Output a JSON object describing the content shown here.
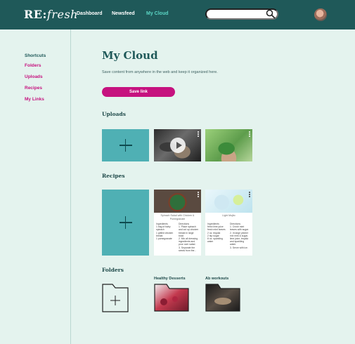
{
  "header": {
    "logo_prefix": "RE:",
    "logo_script": "fresh",
    "nav": [
      {
        "label": "Dashboard",
        "active": false
      },
      {
        "label": "Newsfeed",
        "active": false
      },
      {
        "label": "My Cloud",
        "active": true
      }
    ],
    "search": {
      "value": "",
      "placeholder": ""
    },
    "icons": {
      "search": "search-icon",
      "avatar": "user-avatar"
    }
  },
  "sidebar": {
    "items": [
      {
        "label": "Shortcuts"
      },
      {
        "label": "Folders"
      },
      {
        "label": "Uploads"
      },
      {
        "label": "Recipes"
      },
      {
        "label": "My Links"
      }
    ]
  },
  "main": {
    "title": "My Cloud",
    "subtitle": "Save content from anywhere in the web and keep it organized here.",
    "save_link_label": "Save link",
    "uploads_title": "Uploads",
    "recipes_title": "Recipes",
    "folders_title": "Folders",
    "recipes": [
      {
        "title": "Spinach Salad with Chicken & Pomegranate",
        "ingredients": "Ingredients\n1 bag of baby spinach\n1 grilled chicken breast\n1 pomegranate",
        "directions": "Directions\n1. Place spinach and cut up chicken breast in large bowl.\n2. Mix all dressing ingredients and pour over salad.\n3. Separate the seeds from the..."
      },
      {
        "title": "Light Mojito",
        "ingredients": "Ingredients\nfresh lime juice\nfresh mint leaves\n2 oz. tequila\n2 tsp sugar\n8 oz. sparkling water",
        "directions": "Directions\n1. Crush mint leaves with sugar.\n2. In large pitcher mix mint & sugar, lime juice, tequila and sparkling water.\n3. Serve with ice."
      }
    ],
    "folders": [
      {
        "label": ""
      },
      {
        "label": "Healthy Desserts"
      },
      {
        "label": "Ab workouts"
      }
    ]
  },
  "colors": {
    "header_bg": "#1f5959",
    "page_bg": "#e4f3ee",
    "accent_pink": "#c6127f",
    "accent_teal": "#5bd6c5",
    "add_tile": "#4fb0b4"
  }
}
